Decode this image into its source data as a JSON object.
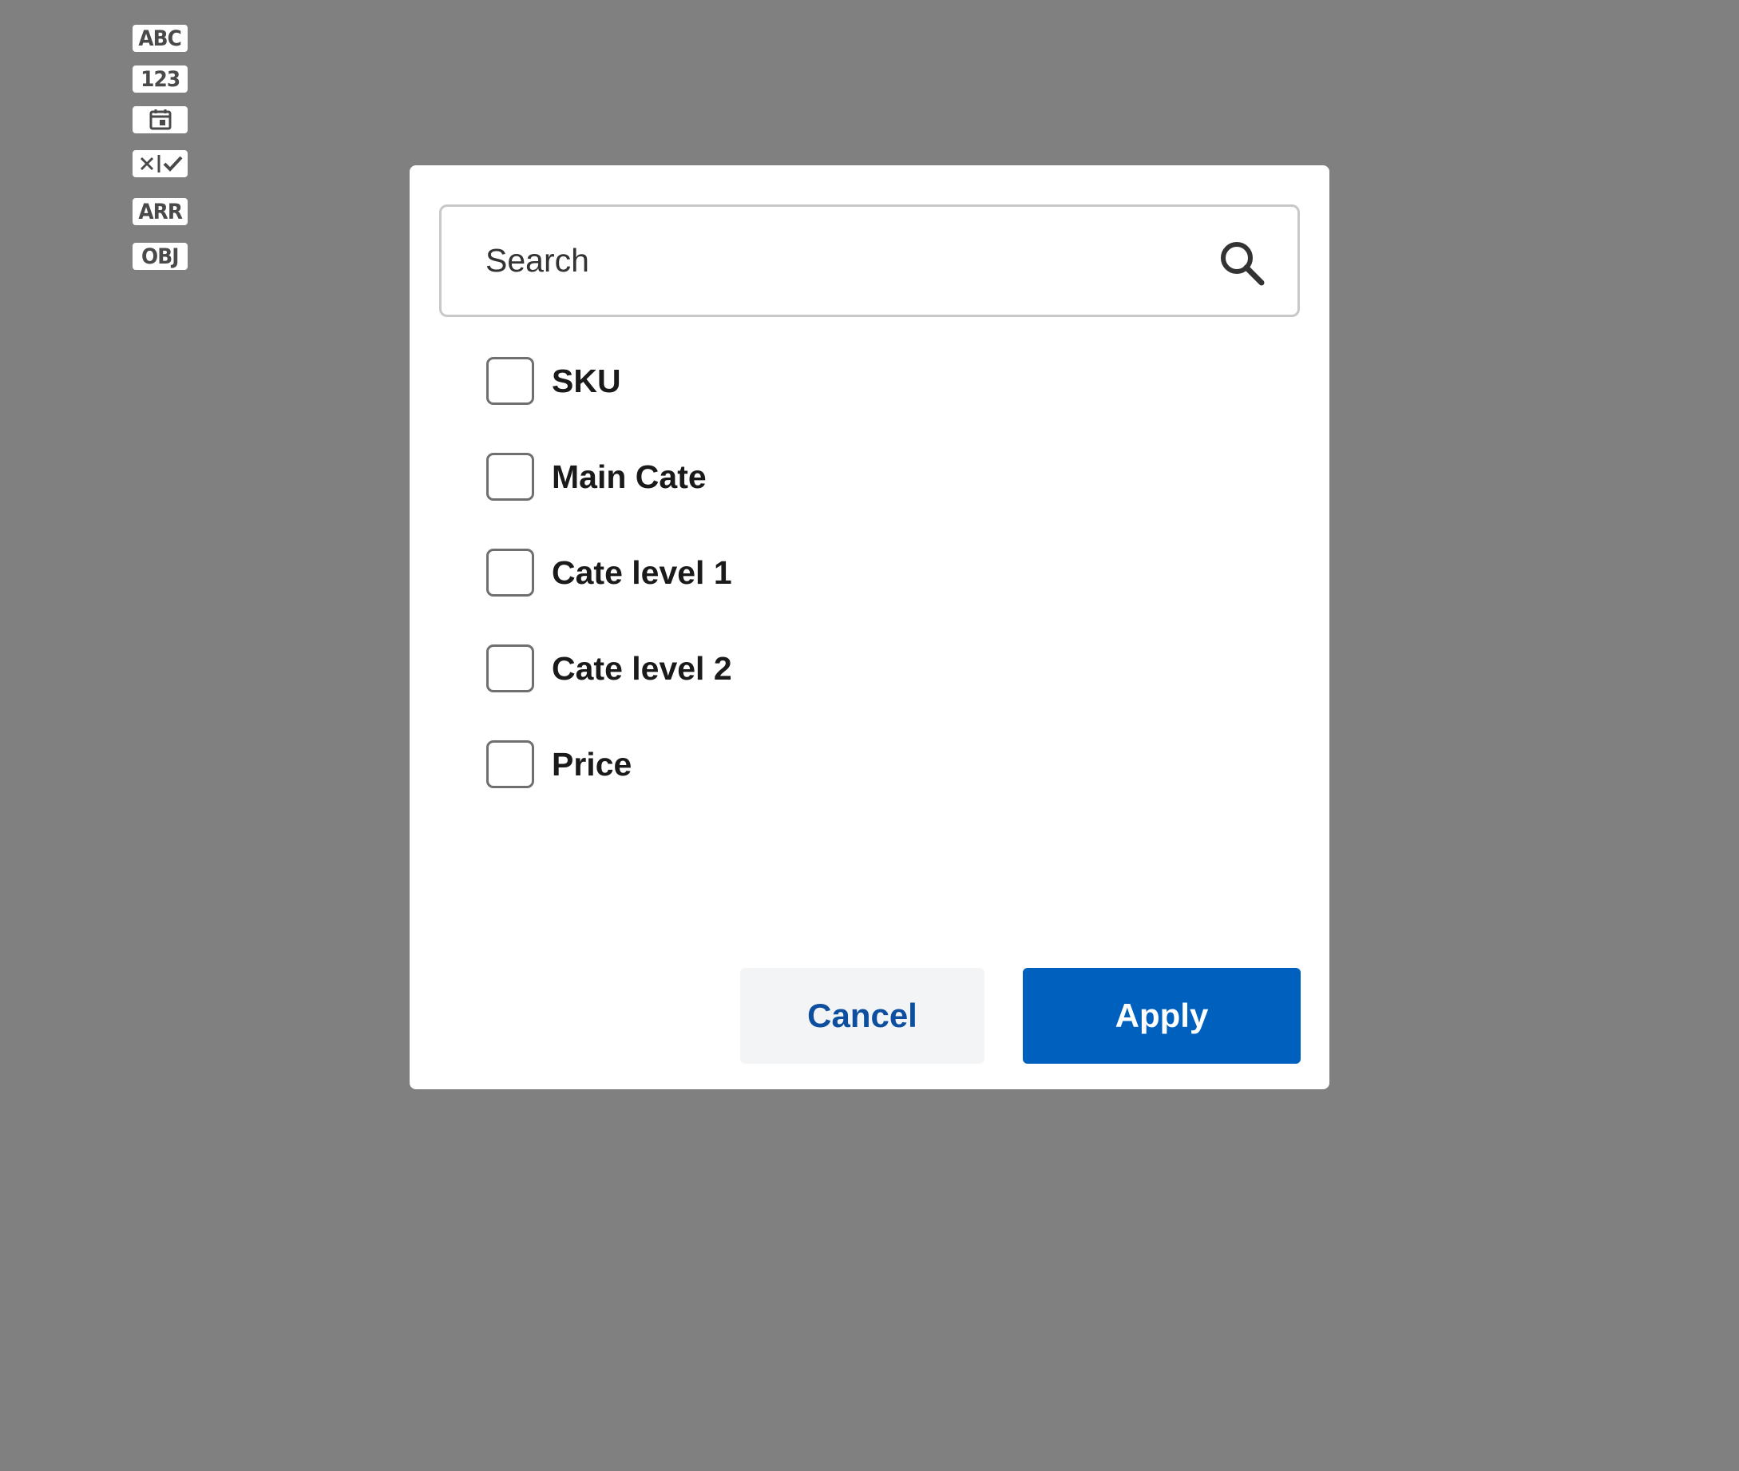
{
  "type_icons": [
    {
      "name": "string-type-icon",
      "text": "ABC"
    },
    {
      "name": "number-type-icon",
      "text": "123"
    },
    {
      "name": "date-type-icon",
      "icon": "calendar"
    },
    {
      "name": "boolean-type-icon",
      "icon": "x-check"
    },
    {
      "name": "array-type-icon",
      "text": "ARR"
    },
    {
      "name": "object-type-icon",
      "text": "OBJ"
    }
  ],
  "dialog": {
    "search": {
      "placeholder": "Search",
      "value": "",
      "icon": "search-icon"
    },
    "options": [
      {
        "label": "SKU",
        "checked": false
      },
      {
        "label": "Main Cate",
        "checked": false
      },
      {
        "label": "Cate level 1",
        "checked": false
      },
      {
        "label": "Cate level 2",
        "checked": false
      },
      {
        "label": "Price",
        "checked": false
      }
    ],
    "buttons": {
      "cancel_label": "Cancel",
      "apply_label": "Apply"
    }
  },
  "colors": {
    "backdrop": "#808080",
    "primary": "#0060bd",
    "cancel_text": "#0d4f9e",
    "cancel_bg": "#f2f4f6"
  }
}
